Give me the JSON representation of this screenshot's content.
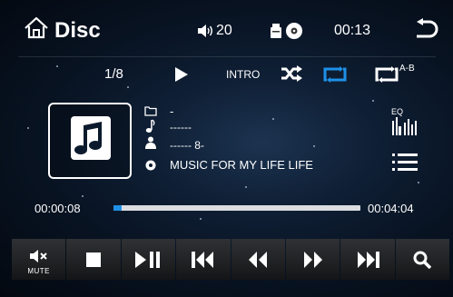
{
  "header": {
    "title": "Disc",
    "volume": "20",
    "clock": "00:13"
  },
  "mode_bar": {
    "track_counter": "1/8",
    "intro_label": "INTRO",
    "ab_label": "A-B"
  },
  "track_info": {
    "folder": "-",
    "title": "------",
    "artist": "------ 8-",
    "album": "MUSIC FOR MY LIFE LIFE"
  },
  "eq_label": "EQ",
  "progress": {
    "elapsed": "00:00:08",
    "total": "00:04:04",
    "fraction": 0.033
  },
  "controls": {
    "mute_label": "MUTE"
  },
  "colors": {
    "accent": "#1e90e8",
    "text": "#ffffff"
  }
}
